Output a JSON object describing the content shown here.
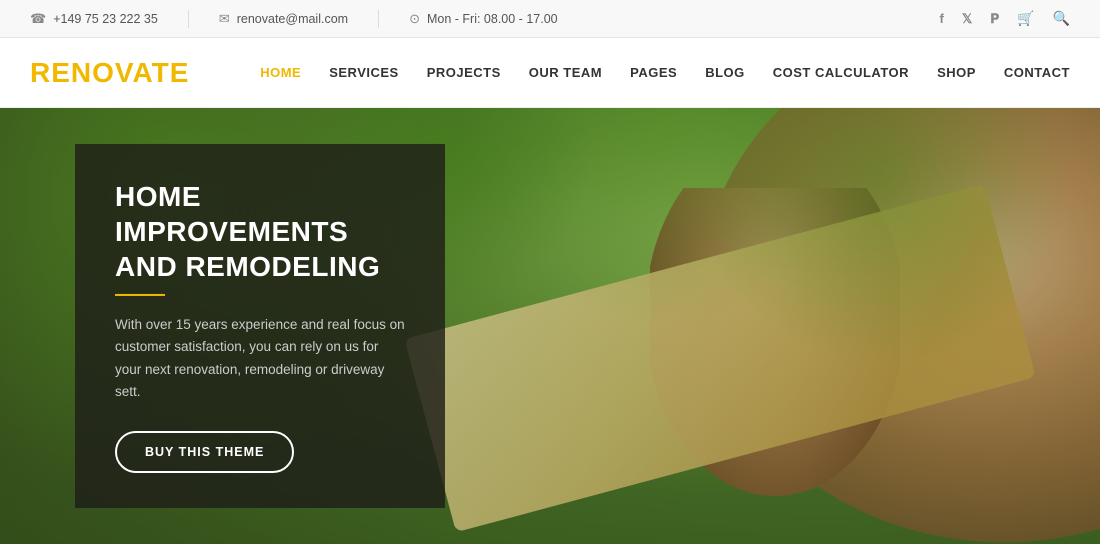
{
  "topbar": {
    "phone_icon": "☎",
    "phone": "+149 75 23 222 35",
    "email_icon": "✉",
    "email": "renovate@mail.com",
    "clock_icon": "🕐",
    "hours": "Mon - Fri: 08.00 - 17.00",
    "social": {
      "facebook": "f",
      "twitter": "t",
      "pinterest": "p",
      "cart": "🛒",
      "search": "🔍"
    }
  },
  "header": {
    "logo": "RENOVATE",
    "nav": [
      {
        "label": "HOME",
        "active": true
      },
      {
        "label": "SERVICES",
        "active": false
      },
      {
        "label": "PROJECTS",
        "active": false
      },
      {
        "label": "OUR TEAM",
        "active": false
      },
      {
        "label": "PAGES",
        "active": false
      },
      {
        "label": "BLOG",
        "active": false
      },
      {
        "label": "COST CALCULATOR",
        "active": false
      },
      {
        "label": "SHOP",
        "active": false
      },
      {
        "label": "CONTACT",
        "active": false
      }
    ]
  },
  "hero": {
    "title_line1": "HOME IMPROVEMENTS",
    "title_line2": "AND REMODELING",
    "description": "With over 15 years experience and real focus on customer satisfaction, you can rely on us for your next renovation, remodeling or driveway sett.",
    "button_label": "BUY THIS THEME"
  },
  "colors": {
    "accent": "#f0b800",
    "text_dark": "#333333",
    "text_light": "#cccccc",
    "overlay_bg": "rgba(30,30,25,0.82)"
  }
}
